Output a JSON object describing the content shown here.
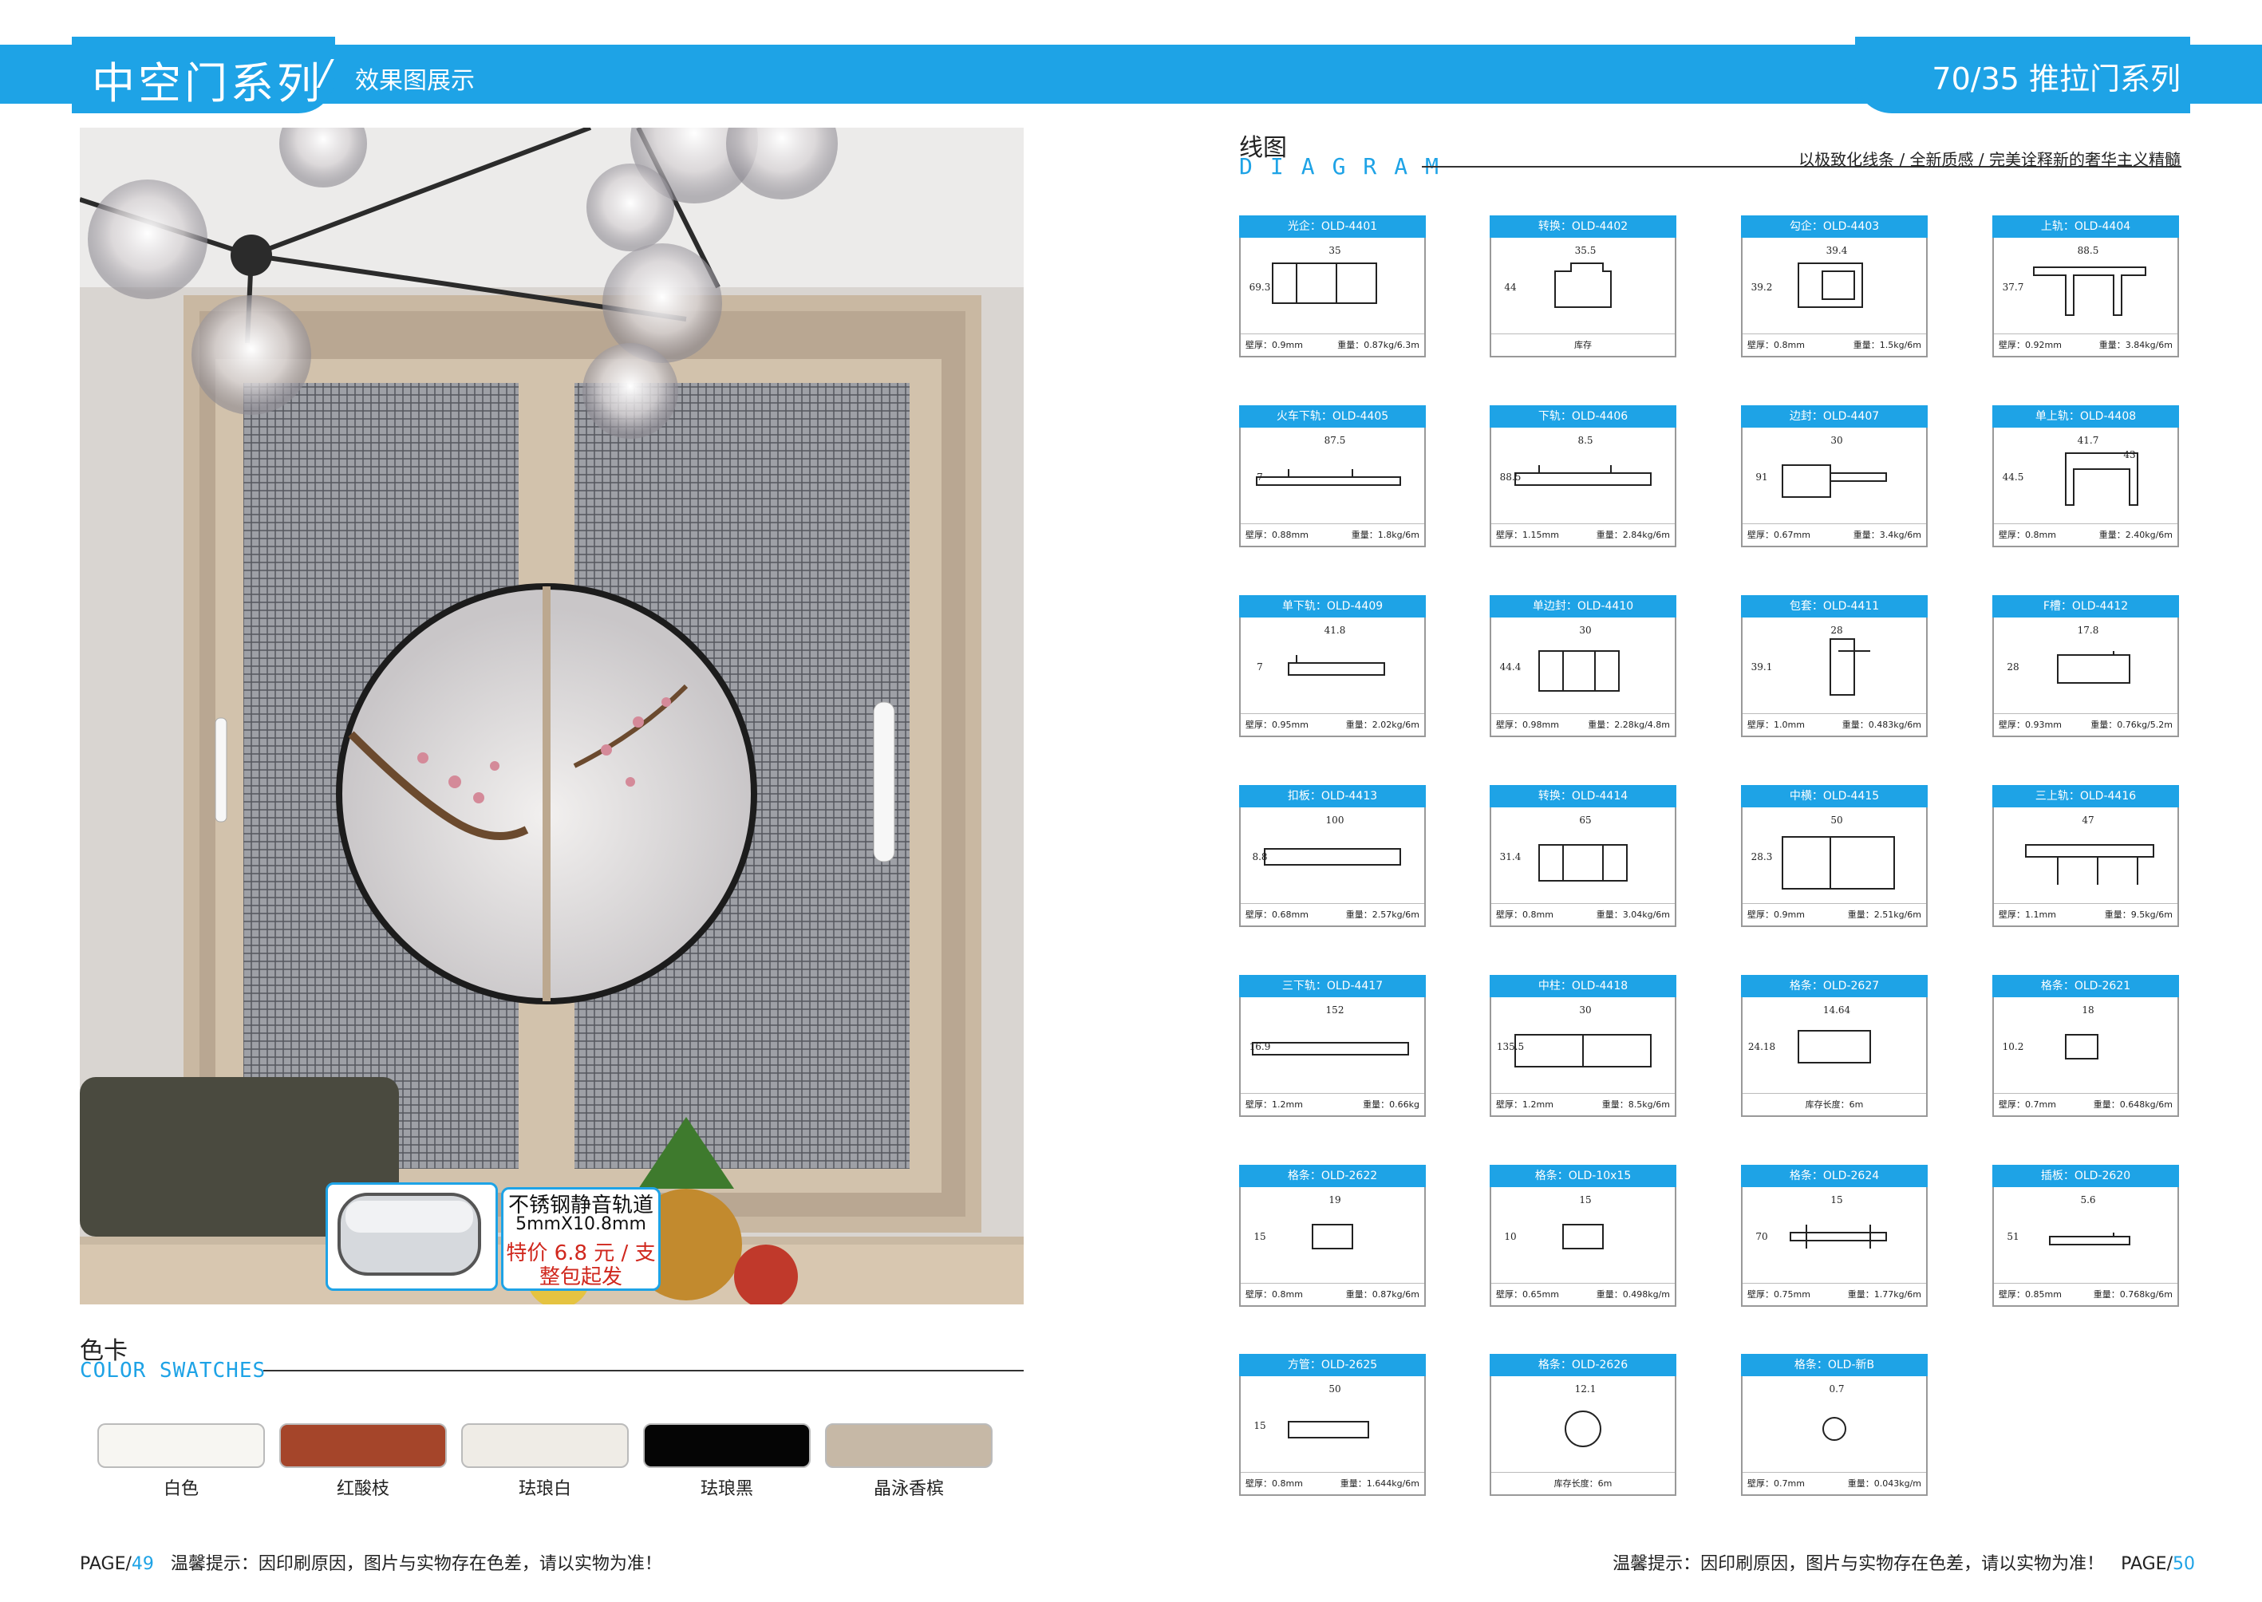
{
  "header": {
    "series_title": "中空门系列",
    "separator": "/",
    "sub_title": "效果图展示",
    "right_title": "70/35 推拉门系列"
  },
  "callout": {
    "line1": "不锈钢静音轨道",
    "line2": "5mmX10.8mm",
    "line3": "特价 6.8 元 / 支",
    "line4": "整包起发"
  },
  "swatches": {
    "title": "色卡",
    "subtitle": "COLOR SWATCHES",
    "items": [
      {
        "label": "白色",
        "color": "#f7f6f2"
      },
      {
        "label": "红酸枝",
        "color": "#a5452a"
      },
      {
        "label": "珐琅白",
        "color": "#efece6"
      },
      {
        "label": "珐琅黑",
        "color": "#050505"
      },
      {
        "label": "晶泳香槟",
        "color": "#c6b8a6"
      }
    ]
  },
  "diagram": {
    "title": "线图",
    "subtitle": "DIAGRAM",
    "slogan": "以极致化线条 / 全新质感 / 完美诠释新的奢华主义精髓",
    "profiles": [
      {
        "name": "光企：OLD-4401",
        "dims": [
          "35",
          "69.3"
        ],
        "foot": [
          "壁厚：0.9mm",
          "重量：0.87kg/6.3m"
        ]
      },
      {
        "name": "转换：OLD-4402",
        "dims": [
          "35.5",
          "44"
        ],
        "foot": [
          "库存"
        ]
      },
      {
        "name": "勾企：OLD-4403",
        "dims": [
          "39.4",
          "39.2"
        ],
        "foot": [
          "壁厚：0.8mm",
          "重量：1.5kg/6m"
        ]
      },
      {
        "name": "上轨：OLD-4404",
        "dims": [
          "88.5",
          "37.7"
        ],
        "foot": [
          "壁厚：0.92mm",
          "重量：3.84kg/6m"
        ]
      },
      {
        "name": "火车下轨：OLD-4405",
        "dims": [
          "87.5",
          "7"
        ],
        "foot": [
          "壁厚：0.88mm",
          "重量：1.8kg/6m"
        ]
      },
      {
        "name": "下轨：OLD-4406",
        "dims": [
          "8.5",
          "88.5"
        ],
        "foot": [
          "壁厚：1.15mm",
          "重量：2.84kg/6m"
        ]
      },
      {
        "name": "边封：OLD-4407",
        "dims": [
          "30",
          "91"
        ],
        "foot": [
          "壁厚：0.67mm",
          "重量：3.4kg/6m"
        ]
      },
      {
        "name": "单上轨：OLD-4408",
        "dims": [
          "41.7",
          "44.5",
          "43"
        ],
        "foot": [
          "壁厚：0.8mm",
          "重量：2.40kg/6m"
        ]
      },
      {
        "name": "单下轨：OLD-4409",
        "dims": [
          "41.8",
          "7"
        ],
        "foot": [
          "壁厚：0.95mm",
          "重量：2.02kg/6m"
        ]
      },
      {
        "name": "单边封：OLD-4410",
        "dims": [
          "30",
          "44.4"
        ],
        "foot": [
          "壁厚：0.98mm",
          "重量：2.28kg/4.8m"
        ]
      },
      {
        "name": "包套：OLD-4411",
        "dims": [
          "28",
          "39.1"
        ],
        "foot": [
          "壁厚：1.0mm",
          "重量：0.483kg/6m"
        ]
      },
      {
        "name": "F槽：OLD-4412",
        "dims": [
          "17.8",
          "28"
        ],
        "foot": [
          "壁厚：0.93mm",
          "重量：0.76kg/5.2m"
        ]
      },
      {
        "name": "扣板：OLD-4413",
        "dims": [
          "100",
          "8.8"
        ],
        "foot": [
          "壁厚：0.68mm",
          "重量：2.57kg/6m"
        ]
      },
      {
        "name": "转换：OLD-4414",
        "dims": [
          "65",
          "31.4"
        ],
        "foot": [
          "壁厚：0.8mm",
          "重量：3.04kg/6m"
        ]
      },
      {
        "name": "中横：OLD-4415",
        "dims": [
          "50",
          "28.3"
        ],
        "foot": [
          "壁厚：0.9mm",
          "重量：2.51kg/6m"
        ]
      },
      {
        "name": "三上轨：OLD-4416",
        "dims": [
          "47"
        ],
        "foot": [
          "壁厚：1.1mm",
          "重量：9.5kg/6m"
        ]
      },
      {
        "name": "三下轨：OLD-4417",
        "dims": [
          "152",
          "16.9"
        ],
        "foot": [
          "壁厚：1.2mm",
          "重量：0.66kg"
        ]
      },
      {
        "name": "中柱：OLD-4418",
        "dims": [
          "30",
          "135.5"
        ],
        "foot": [
          "壁厚：1.2mm",
          "重量：8.5kg/6m"
        ]
      },
      {
        "name": "格条：OLD-2627",
        "dims": [
          "14.64",
          "24.18"
        ],
        "foot": [
          "库存长度：6m"
        ]
      },
      {
        "name": "格条：OLD-2621",
        "dims": [
          "18",
          "10.2"
        ],
        "foot": [
          "壁厚：0.7mm",
          "重量：0.648kg/6m"
        ]
      },
      {
        "name": "格条：OLD-2622",
        "dims": [
          "19",
          "15"
        ],
        "foot": [
          "壁厚：0.8mm",
          "重量：0.87kg/6m"
        ]
      },
      {
        "name": "格条：OLD-10x15",
        "dims": [
          "15",
          "10"
        ],
        "foot": [
          "壁厚：0.65mm",
          "重量：0.498kg/m"
        ]
      },
      {
        "name": "格条：OLD-2624",
        "dims": [
          "15",
          "70"
        ],
        "foot": [
          "壁厚：0.75mm",
          "重量：1.77kg/6m"
        ]
      },
      {
        "name": "插板：OLD-2620",
        "dims": [
          "5.6",
          "51"
        ],
        "foot": [
          "壁厚：0.85mm",
          "重量：0.768kg/6m"
        ]
      },
      {
        "name": "方管：OLD-2625",
        "dims": [
          "50",
          "15"
        ],
        "foot": [
          "壁厚：0.8mm",
          "重量：1.644kg/6m"
        ]
      },
      {
        "name": "格条：OLD-2626",
        "dims": [
          "12.1"
        ],
        "foot": [
          "库存长度：6m"
        ]
      },
      {
        "name": "格条：OLD-新B",
        "dims": [
          "0.7"
        ],
        "foot": [
          "壁厚：0.7mm",
          "重量：0.043kg/m"
        ]
      }
    ]
  },
  "footer": {
    "left_page_label": "PAGE/",
    "left_page_num": "49",
    "left_tip": "温馨提示：因印刷原因，图片与实物存在色差，请以实物为准！",
    "right_tip": "温馨提示：因印刷原因，图片与实物存在色差，请以实物为准！",
    "right_page_label": "PAGE/",
    "right_page_num": "50"
  }
}
